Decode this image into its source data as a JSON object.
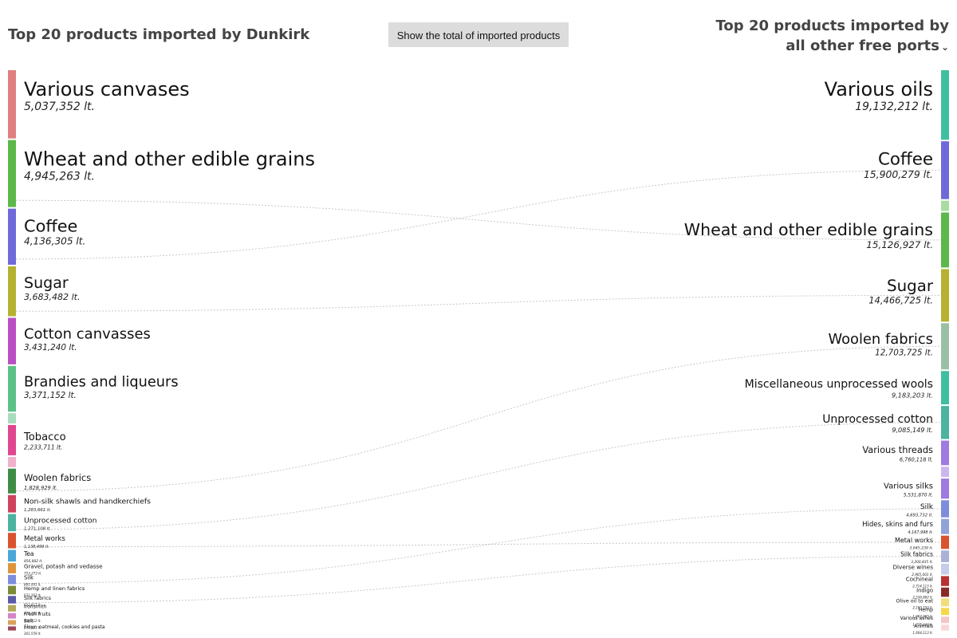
{
  "header": {
    "left_title": "Top 20 products imported by Dunkirk",
    "button_label": "Show the total of imported products",
    "right_title_line1": "Top 20 products imported by",
    "right_title_dropdown": "all other free ports"
  },
  "icons": {
    "dropdown": "chevron-down-icon"
  },
  "chart_data": {
    "type": "parallel-ranked-bars",
    "unit": "lt.",
    "left": {
      "title": "Top 20 products imported by Dunkirk",
      "items": [
        {
          "name": "Various canvases",
          "value_label": "5,037,352 lt.",
          "value": 5037352,
          "color": "#e07f7f"
        },
        {
          "name": "Wheat and other edible grains",
          "value_label": "4,945,263 lt.",
          "value": 4945263,
          "color": "#5db84b"
        },
        {
          "name": "Coffee",
          "value_label": "4,136,305 lt.",
          "value": 4136305,
          "color": "#6e6ad9"
        },
        {
          "name": "Sugar",
          "value_label": "3,683,482 lt.",
          "value": 3683482,
          "color": "#b5b232"
        },
        {
          "name": "Cotton canvasses",
          "value_label": "3,431,240 lt.",
          "value": 3431240,
          "color": "#b94fc1"
        },
        {
          "name": "Brandies and liqueurs",
          "value_label": "3,371,152 lt.",
          "value": 3371152,
          "color": "#5cc185"
        },
        {
          "name": "Tobacco",
          "value_label": "2,233,711 lt.",
          "value": 2233711,
          "color": "#e0478e"
        },
        {
          "name": "Woolen fabrics",
          "value_label": "1,828,929 lt.",
          "value": 1828929,
          "color": "#3f8c45"
        },
        {
          "name": "Non-silk shawls and handkerchiefs",
          "value_label": "1,283,661 lt.",
          "value": 1283661,
          "color": "#d0435d"
        },
        {
          "name": "Unprocessed cotton",
          "value_label": "1,271,108 lt.",
          "value": 1271108,
          "color": "#4bb39f"
        },
        {
          "name": "Metal works",
          "value_label": "1,138,499 lt.",
          "value": 1138499,
          "color": "#d9532e"
        },
        {
          "name": "Tea",
          "value_label": "856,882 lt.",
          "value": 856882,
          "color": "#4aa8d8"
        },
        {
          "name": "Gravel, potash and vedasse",
          "value_label": "753,273 lt.",
          "value": 753273,
          "color": "#e0953a"
        },
        {
          "name": "Silk",
          "value_label": "685,991 lt.",
          "value": 685991,
          "color": "#7d8ddb"
        },
        {
          "name": "Hemp and linen fabrics",
          "value_label": "631,263 lt.",
          "value": 631263,
          "color": "#7b8a38"
        },
        {
          "name": "Silk fabrics",
          "value_label": "553,917 lt.",
          "value": 553917,
          "color": "#5a5aa8"
        },
        {
          "name": "Ironsmith",
          "value_label": "478,102 lt.",
          "value": 478102,
          "color": "#b3a85a"
        },
        {
          "name": "Fresh fruits",
          "value_label": "400,312 lt.",
          "value": 400312,
          "color": "#d683c7"
        },
        {
          "name": "Salt",
          "value_label": "345,227 lt.",
          "value": 345227,
          "color": "#d9a25a"
        },
        {
          "name": "Flour, oatmeal, cookies and pasta",
          "value_label": "301,559 lt.",
          "value": 301559,
          "color": "#a0465a"
        }
      ]
    },
    "right": {
      "title": "Top 20 products imported by all other free ports",
      "items": [
        {
          "name": "Various oils",
          "value_label": "19,132,212 lt.",
          "value": 19132212,
          "color": "#3fbf9f"
        },
        {
          "name": "Coffee",
          "value_label": "15,900,279 lt.",
          "value": 15900279,
          "color": "#6e6ad9"
        },
        {
          "name": "Wheat and other edible grains",
          "value_label": "15,126,927 lt.",
          "value": 15126927,
          "color": "#5db84b"
        },
        {
          "name": "Sugar",
          "value_label": "14,466,725 lt.",
          "value": 14466725,
          "color": "#b5b232"
        },
        {
          "name": "Woolen fabrics",
          "value_label": "12,703,725 lt.",
          "value": 12703725,
          "color": "#9bbfa5"
        },
        {
          "name": "Miscellaneous unprocessed wools",
          "value_label": "9,183,203 lt.",
          "value": 9183203,
          "color": "#3fbf9f"
        },
        {
          "name": "Unprocessed cotton",
          "value_label": "9,085,149 lt.",
          "value": 9085149,
          "color": "#4bb39f"
        },
        {
          "name": "Various threads",
          "value_label": "6,760,118 lt.",
          "value": 6760118,
          "color": "#9f7ae0"
        },
        {
          "name": "Various silks",
          "value_label": "5,531,870 lt.",
          "value": 5531870,
          "color": "#9f7ae0"
        },
        {
          "name": "Silk",
          "value_label": "4,693,732 lt.",
          "value": 4693732,
          "color": "#7d8ddb"
        },
        {
          "name": "Hides, skins and furs",
          "value_label": "4,167,998 lt.",
          "value": 4167998,
          "color": "#8fa3d8"
        },
        {
          "name": "Metal works",
          "value_label": "3,645,239 lt.",
          "value": 3645239,
          "color": "#d9532e"
        },
        {
          "name": "Silk fabrics",
          "value_label": "3,200,835 lt.",
          "value": 3200835,
          "color": "#aab0d6"
        },
        {
          "name": "Diverse wines",
          "value_label": "2,965,001 lt.",
          "value": 2965001,
          "color": "#c5cde8"
        },
        {
          "name": "Cochineal",
          "value_label": "2,714,113 lt.",
          "value": 2714113,
          "color": "#b83232"
        },
        {
          "name": "Indigo",
          "value_label": "2,536,882 lt.",
          "value": 2536882,
          "color": "#8a2a2a"
        },
        {
          "name": "Olive oil to eat",
          "value_label": "2,180,559 lt.",
          "value": 2180559,
          "color": "#f0df7a"
        },
        {
          "name": "Hemp",
          "value_label": "1,962,005 lt.",
          "value": 1962005,
          "color": "#f5d84a"
        },
        {
          "name": "Various ashes",
          "value_label": "1,775,640 lt.",
          "value": 1775640,
          "color": "#f5c6c6"
        },
        {
          "name": "Animals",
          "value_label": "1,604,113 lt.",
          "value": 1604113,
          "color": "#f7d6d6"
        }
      ]
    },
    "left_extra_segments": [
      {
        "after": "Brandies and liqueurs",
        "color": "#a8dcbc"
      },
      {
        "after": "Tobacco",
        "color": "#f2b0cb"
      }
    ],
    "right_extra_segments": [
      {
        "after": "Coffee",
        "color": "#a8dca0"
      },
      {
        "after": "Various threads",
        "color": "#c9b8f0"
      }
    ],
    "links": [
      {
        "left": "Wheat and other edible grains",
        "right": "Wheat and other edible grains"
      },
      {
        "left": "Coffee",
        "right": "Coffee"
      },
      {
        "left": "Sugar",
        "right": "Sugar"
      },
      {
        "left": "Woolen fabrics",
        "right": "Woolen fabrics"
      },
      {
        "left": "Unprocessed cotton",
        "right": "Unprocessed cotton"
      },
      {
        "left": "Metal works",
        "right": "Metal works"
      },
      {
        "left": "Silk",
        "right": "Silk"
      },
      {
        "left": "Silk fabrics",
        "right": "Silk fabrics"
      }
    ]
  }
}
